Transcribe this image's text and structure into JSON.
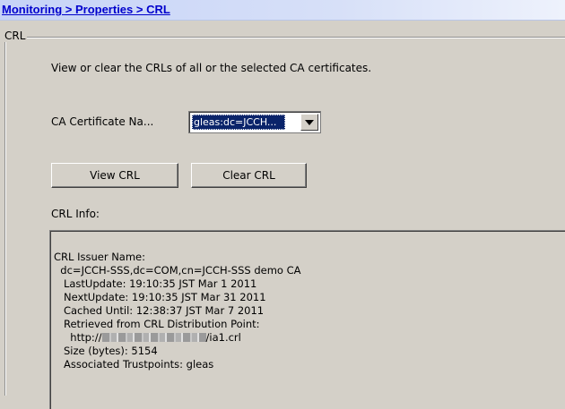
{
  "breadcrumb": "Monitoring > Properties > CRL",
  "group": {
    "legend": "CRL",
    "description": "View or clear the CRLs of all or the selected CA certificates.",
    "ca_label": "CA Certificate Na...",
    "ca_select_value": "gleas:dc=JCCH...",
    "buttons": {
      "view": "View CRL",
      "clear": "Clear CRL"
    },
    "info_label": "CRL Info:"
  },
  "crl_info": {
    "line1": "CRL Issuer Name:",
    "line2": "  dc=JCCH-SSS,dc=COM,cn=JCCH-SSS demo CA",
    "line3": "   LastUpdate: 19:10:35 JST Mar 1 2011",
    "line4": "   NextUpdate: 19:10:35 JST Mar 31 2011",
    "line5": "   Cached Until: 12:38:37 JST Mar 7 2011",
    "line6": "   Retrieved from CRL Distribution Point:",
    "line7_prefix": "     http://",
    "line7_suffix": "/ia1.crl",
    "line8": "   Size (bytes): 5154",
    "line9": "   Associated Trustpoints: gleas"
  }
}
